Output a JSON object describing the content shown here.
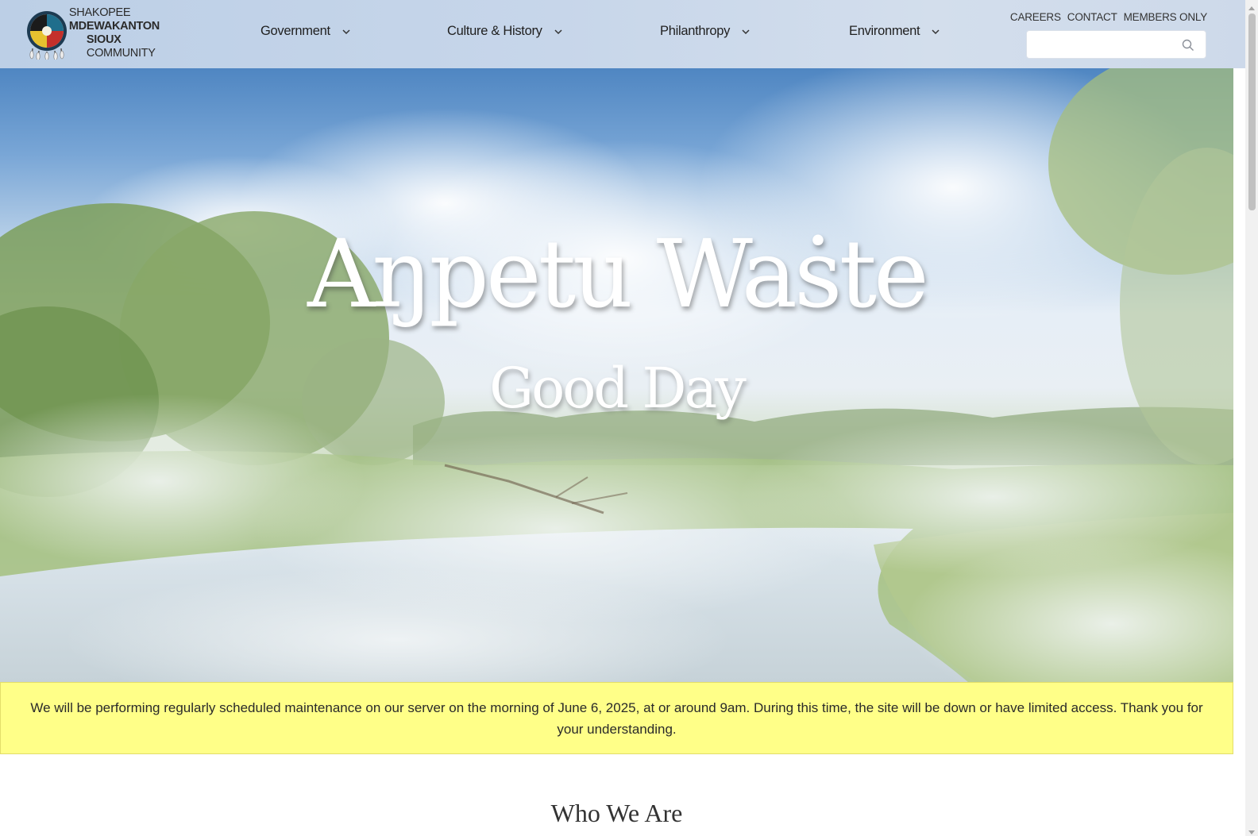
{
  "header": {
    "logo": {
      "line1_light": "SHAKOPEE ",
      "line1_bold": "MDEWAKANTON",
      "line2_bold": "SIOUX",
      "line2_light": " COMMUNITY"
    },
    "nav": [
      {
        "label": "Government"
      },
      {
        "label": "Culture & History"
      },
      {
        "label": "Philanthropy"
      },
      {
        "label": "Environment"
      }
    ],
    "utility_links": [
      "CAREERS",
      "CONTACT",
      "MEMBERS ONLY"
    ],
    "search": {
      "placeholder": "",
      "value": ""
    }
  },
  "hero": {
    "title": "Aŋpetu Waṡte",
    "subtitle": "Good Day"
  },
  "notice": {
    "text": "We will be performing regularly scheduled maintenance on our server on the morning of June 6, 2025, at or around 9am. During this time, the site will be down or have limited access. Thank you for your understanding."
  },
  "sections": {
    "who_we_are": "Who We Are"
  },
  "colors": {
    "notice_bg": "#ffff88",
    "header_bg": "#c7d6ea"
  }
}
